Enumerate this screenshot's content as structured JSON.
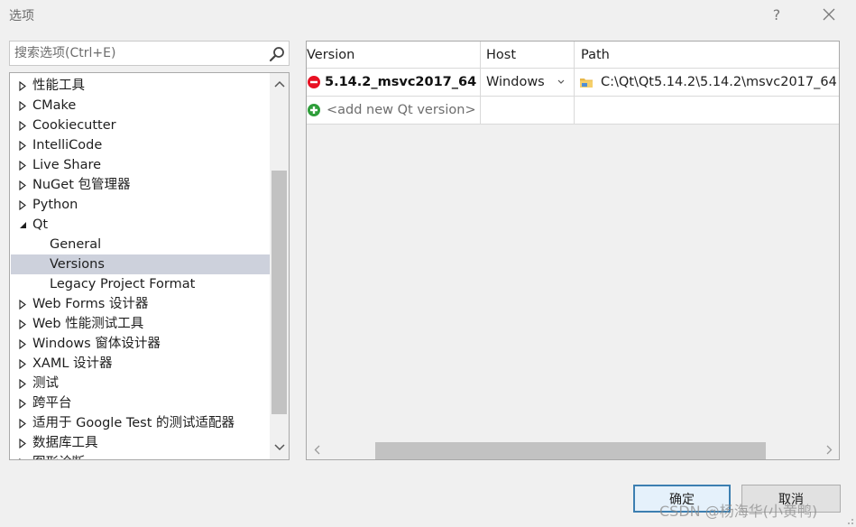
{
  "window": {
    "title": "选项",
    "help_label": "?",
    "close_label": "✕"
  },
  "search": {
    "placeholder": "搜索选项(Ctrl+E)",
    "value": ""
  },
  "tree": {
    "items": [
      {
        "label": "性能工具",
        "state": "collapsed",
        "level": 0
      },
      {
        "label": "CMake",
        "state": "collapsed",
        "level": 0
      },
      {
        "label": "Cookiecutter",
        "state": "collapsed",
        "level": 0
      },
      {
        "label": "IntelliCode",
        "state": "collapsed",
        "level": 0
      },
      {
        "label": "Live Share",
        "state": "collapsed",
        "level": 0
      },
      {
        "label": "NuGet 包管理器",
        "state": "collapsed",
        "level": 0
      },
      {
        "label": "Python",
        "state": "collapsed",
        "level": 0
      },
      {
        "label": "Qt",
        "state": "expanded",
        "level": 0
      },
      {
        "label": "General",
        "state": "leaf",
        "level": 1
      },
      {
        "label": "Versions",
        "state": "leaf",
        "level": 1,
        "selected": true
      },
      {
        "label": "Legacy Project Format",
        "state": "leaf",
        "level": 1
      },
      {
        "label": "Web Forms 设计器",
        "state": "collapsed",
        "level": 0
      },
      {
        "label": "Web 性能测试工具",
        "state": "collapsed",
        "level": 0
      },
      {
        "label": "Windows 窗体设计器",
        "state": "collapsed",
        "level": 0
      },
      {
        "label": "XAML 设计器",
        "state": "collapsed",
        "level": 0
      },
      {
        "label": "测试",
        "state": "collapsed",
        "level": 0
      },
      {
        "label": "跨平台",
        "state": "collapsed",
        "level": 0
      },
      {
        "label": "适用于 Google Test 的测试适配器",
        "state": "collapsed",
        "level": 0
      },
      {
        "label": "数据库工具",
        "state": "collapsed",
        "level": 0
      },
      {
        "label": "图形诊断",
        "state": "collapsed",
        "level": 0
      }
    ]
  },
  "grid": {
    "headers": {
      "version": "Version",
      "host": "Host",
      "path": "Path"
    },
    "rows": [
      {
        "version": "5.14.2_msvc2017_64",
        "host": "Windows",
        "path": "C:\\Qt\\Qt5.14.2\\5.14.2\\msvc2017_64",
        "status_icon": "remove-icon"
      }
    ],
    "add_row_label": "<add new Qt version>"
  },
  "buttons": {
    "ok_label": "确定",
    "cancel_label": "取消"
  },
  "watermark": "CSDN @杨海华(小黄鸭)",
  "colors": {
    "selection": "#cdd1dc",
    "remove": "#e81123",
    "add": "#2e9e3a",
    "accent": "#3c7fb1"
  }
}
